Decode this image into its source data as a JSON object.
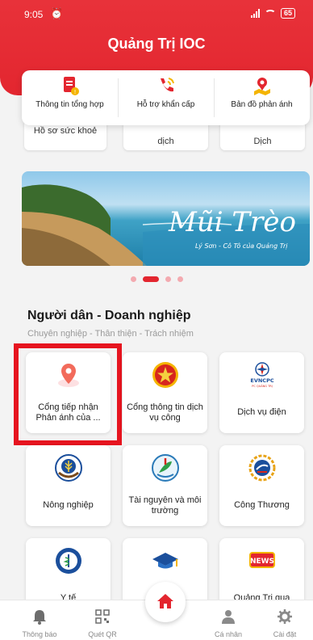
{
  "status": {
    "time": "9:05",
    "battery": "65"
  },
  "header": {
    "title": "Quảng Trị IOC"
  },
  "quick_actions": [
    {
      "label": "Thông tin tổng hợp",
      "icon": "document-icon"
    },
    {
      "label": "Hỗ trợ khẩn cấp",
      "icon": "emergency-phone-icon"
    },
    {
      "label": "Bản đồ phản ánh",
      "icon": "map-report-icon"
    }
  ],
  "peek_items": [
    {
      "line1": "Hồ sơ sức khoẻ",
      "line2": ""
    },
    {
      "line1": "",
      "line2": "dịch"
    },
    {
      "line1": "",
      "line2": "Dịch"
    }
  ],
  "banner": {
    "title": "Mũi Trèo",
    "subtitle": "Lý Sơn - Cô Tô của Quảng Trị"
  },
  "section": {
    "title": "Người dân - Doanh nghiệp",
    "subtitle": "Chuyên nghiệp - Thân thiện - Trách nhiệm"
  },
  "tiles": [
    {
      "label": "Cổng tiếp nhận Phản ánh của ...",
      "icon": "location-pin-icon"
    },
    {
      "label": "Cổng thông tin dịch vụ công",
      "icon": "national-emblem-icon"
    },
    {
      "label": "Dịch vụ điện",
      "icon": "evncpc-logo-icon",
      "logo_text": "EVNCPC",
      "logo_sub": "PC QUẢNG TRỊ"
    },
    {
      "label": "Nông nghiệp",
      "icon": "agriculture-logo-icon"
    },
    {
      "label": "Tài nguyên và môi trường",
      "icon": "environment-logo-icon"
    },
    {
      "label": "Công Thương",
      "icon": "industry-trade-logo-icon"
    },
    {
      "label": "Y tế",
      "icon": "health-logo-icon"
    },
    {
      "label": "",
      "icon": "graduation-cap-icon"
    },
    {
      "label": "Quảng Trị qua",
      "icon": "news-icon",
      "badge": "NEWS"
    }
  ],
  "bottom_nav": {
    "items": [
      {
        "label": "Thông báo",
        "icon": "bell-icon"
      },
      {
        "label": "Quét QR",
        "icon": "qr-code-icon"
      },
      {
        "label": "Cá nhân",
        "icon": "user-icon"
      },
      {
        "label": "Cài đặt",
        "icon": "gear-icon"
      }
    ],
    "home_icon": "home-icon"
  },
  "colors": {
    "primary": "#e3262f",
    "highlight": "#e6141f"
  }
}
